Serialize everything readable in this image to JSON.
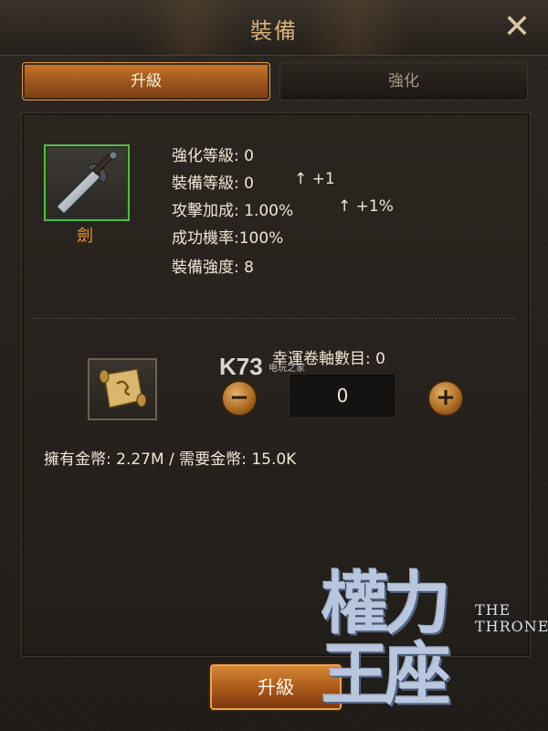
{
  "header": {
    "title": "裝備",
    "close_glyph": "✕"
  },
  "tabs": [
    {
      "label": "升級",
      "active": true
    },
    {
      "label": "強化",
      "active": false
    }
  ],
  "item": {
    "name": "劍",
    "icon": "sword-icon",
    "frame_color": "#5fb24d"
  },
  "stats": [
    {
      "label": "強化等級: 0"
    },
    {
      "label": "裝備等級: 0",
      "increase": "↑ +1"
    },
    {
      "label": "攻擊加成: 1.00%",
      "increase": "↑ +1%"
    },
    {
      "label": "成功機率:100%"
    },
    {
      "label": "裝備強度: 8"
    }
  ],
  "lucky_scroll": {
    "label": "幸運卷軸數目: 0",
    "icon": "scroll-icon",
    "minus_glyph": "−",
    "plus_glyph": "+",
    "value": "0"
  },
  "coins_text": "擁有金幣: 2.27M / 需要金幣: 15.0K",
  "upgrade_button": "升級",
  "logo": {
    "main": "權力王座",
    "the": "THE",
    "throne": "THRONE"
  },
  "watermark": {
    "main": "K73",
    "sub": "电玩之家"
  },
  "colors": {
    "accent": "#c7792b",
    "text": "#efe6d5",
    "item_name": "#e89a3a"
  }
}
